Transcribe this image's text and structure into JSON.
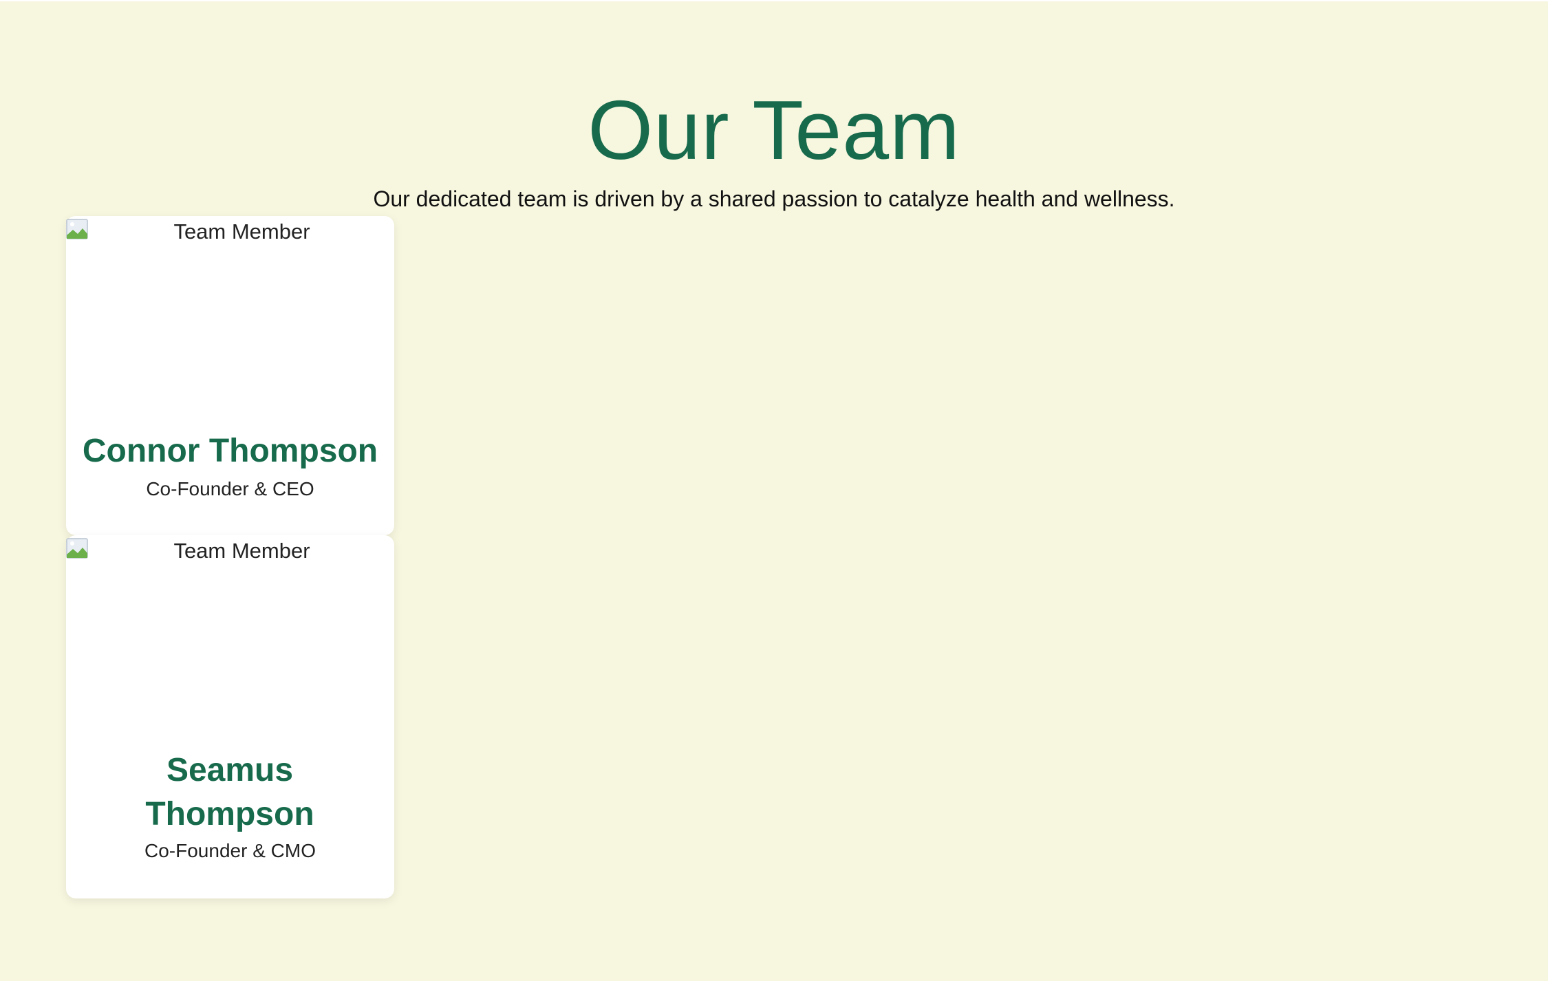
{
  "team": {
    "title": "Our Team",
    "subtitle": "Our dedicated team is driven by a shared passion to catalyze health and wellness.",
    "members": [
      {
        "image_alt": "Team Member",
        "name": "Connor Thompson",
        "role": "Co-Founder & CEO"
      },
      {
        "image_alt": "Team Member",
        "name": "Seamus Thompson",
        "role": "Co-Founder & CMO"
      }
    ]
  },
  "colors": {
    "background": "#f7f6df",
    "accent_green": "#176b4c",
    "card": "#ffffff",
    "text": "#111111"
  }
}
